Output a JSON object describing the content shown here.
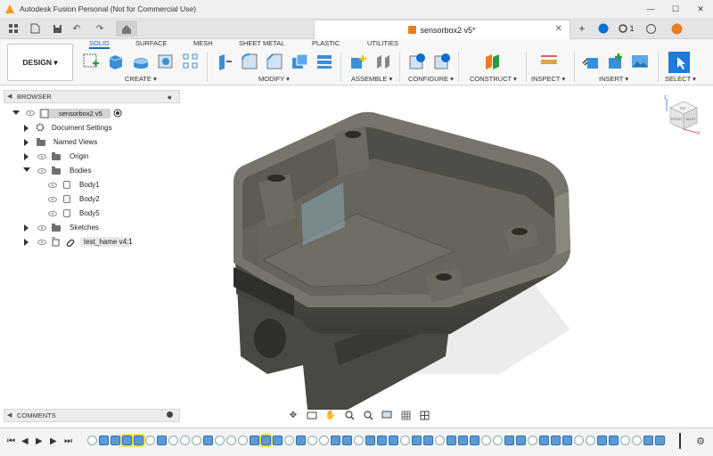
{
  "window": {
    "title": "Autodesk Fusion Personal (Not for Commercial Use)",
    "controls": [
      "—",
      "☐",
      "✕"
    ]
  },
  "quickbar": {
    "document_tab": "sensorbox2 v5*",
    "notification_count": "1"
  },
  "toolbar": {
    "design_label": "DESIGN ▾",
    "workspace_tabs": [
      "SOLID",
      "SURFACE",
      "MESH",
      "SHEET METAL",
      "PLASTIC",
      "UTILITIES"
    ],
    "active_tab": "SOLID",
    "groups": [
      "CREATE ▾",
      "MODIFY ▾",
      "ASSEMBLE ▾",
      "CONFIGURE ▾",
      "CONSTRUCT ▾",
      "INSPECT ▾",
      "INSERT ▾",
      "SELECT ▾"
    ]
  },
  "browser": {
    "header": "BROWSER",
    "root": "sensorbox2 v5",
    "items": [
      {
        "label": "Document Settings"
      },
      {
        "label": "Named Views"
      },
      {
        "label": "Origin"
      },
      {
        "label": "Bodies"
      },
      {
        "label": "Body1"
      },
      {
        "label": "Body2"
      },
      {
        "label": "Body5"
      },
      {
        "label": "Sketches"
      },
      {
        "label": "test_hame v4:1"
      }
    ]
  },
  "comments": {
    "header": "COMMENTS"
  },
  "viewcube": {
    "faces": [
      "TOP",
      "FRONT",
      "RIGHT"
    ],
    "axes": [
      "Z",
      "X"
    ]
  },
  "colors": {
    "accent": "#0b6cd1",
    "part": "#55524b",
    "body_feature": "#5b9bd5",
    "highlight": "#f1e14a"
  }
}
